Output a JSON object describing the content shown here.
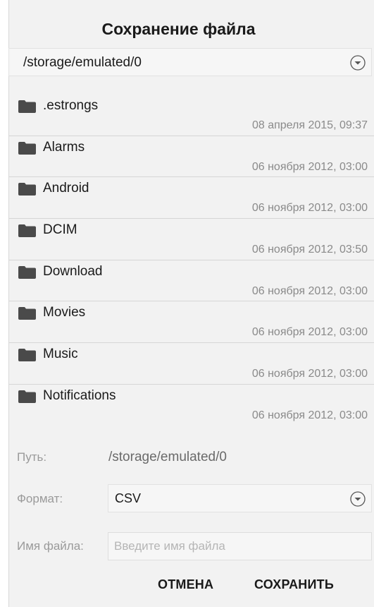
{
  "dialog": {
    "title": "Сохранение файла",
    "current_directory": "/storage/emulated/0"
  },
  "files": [
    {
      "name": ".estrongs",
      "date": "08 апреля 2015, 09:37",
      "icon": "folder-icon"
    },
    {
      "name": "Alarms",
      "date": "06 ноября 2012, 03:00",
      "icon": "folder-icon"
    },
    {
      "name": "Android",
      "date": "06 ноября 2012, 03:00",
      "icon": "folder-icon"
    },
    {
      "name": "DCIM",
      "date": "06 ноября 2012, 03:50",
      "icon": "folder-icon"
    },
    {
      "name": "Download",
      "date": "06 ноября 2012, 03:00",
      "icon": "folder-icon"
    },
    {
      "name": "Movies",
      "date": "06 ноября 2012, 03:00",
      "icon": "folder-icon"
    },
    {
      "name": "Music",
      "date": "06 ноября 2012, 03:00",
      "icon": "folder-icon"
    },
    {
      "name": "Notifications",
      "date": "06 ноября 2012, 03:00",
      "icon": "folder-icon"
    }
  ],
  "form": {
    "path_label": "Путь:",
    "path_value": "/storage/emulated/0",
    "format_label": "Формат:",
    "format_value": "CSV",
    "filename_label": "Имя файла:",
    "filename_value": "",
    "filename_placeholder": "Введите имя файла"
  },
  "buttons": {
    "cancel": "ОТМЕНА",
    "save": "СОХРАНИТЬ"
  },
  "colors": {
    "background": "#f2f2f2",
    "text": "#1a1a1a",
    "secondary_text": "#8a8a8a",
    "divider": "#d6d6d6",
    "folder": "#4a4a4a"
  }
}
